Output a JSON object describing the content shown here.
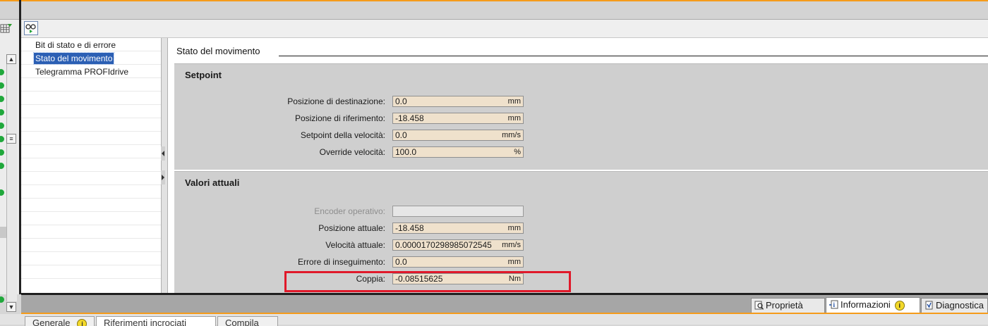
{
  "navigation": {
    "items": [
      {
        "label": "Bit di stato e di errore",
        "selected": false
      },
      {
        "label": "Stato del movimento",
        "selected": true
      },
      {
        "label": "Telegramma PROFIdrive",
        "selected": false
      }
    ]
  },
  "section": {
    "title": "Stato del movimento"
  },
  "setpoint": {
    "title": "Setpoint",
    "rows": [
      {
        "label": "Posizione di destinazione:",
        "value": "0.0",
        "unit": "mm"
      },
      {
        "label": "Posizione di riferimento:",
        "value": "-18.458",
        "unit": "mm"
      },
      {
        "label": "Setpoint della velocità:",
        "value": "0.0",
        "unit": "mm/s"
      },
      {
        "label": "Override velocità:",
        "value": "100.0",
        "unit": "%"
      }
    ]
  },
  "actual_values": {
    "title": "Valori attuali",
    "rows": [
      {
        "label": "Encoder operativo:",
        "value": "",
        "unit": ""
      },
      {
        "label": "Posizione attuale:",
        "value": "-18.458",
        "unit": "mm"
      },
      {
        "label": "Velocità attuale:",
        "value": "0.0000170298985072545",
        "unit": "mm/s"
      },
      {
        "label": "Errore di inseguimento:",
        "value": "0.0",
        "unit": "mm"
      },
      {
        "label": "Coppia:",
        "value": "-0.08515625",
        "unit": "Nm"
      }
    ]
  },
  "inspector_tabs": [
    {
      "label": "Proprietà",
      "icon": "properties-icon"
    },
    {
      "label": "Informazioni",
      "icon": "info-icon"
    },
    {
      "label": "Diagnostica",
      "icon": "diagnostics-icon"
    }
  ],
  "lower_tabs": [
    {
      "label": "Generale"
    },
    {
      "label": "Riferimenti incrociati"
    },
    {
      "label": "Compila"
    }
  ],
  "colors": {
    "accent_orange": "#f59b1a",
    "field_fill": "#efe1cc",
    "selection_blue": "#2b5fb4",
    "highlight_red": "#e0192a",
    "status_green": "#20a83b"
  }
}
